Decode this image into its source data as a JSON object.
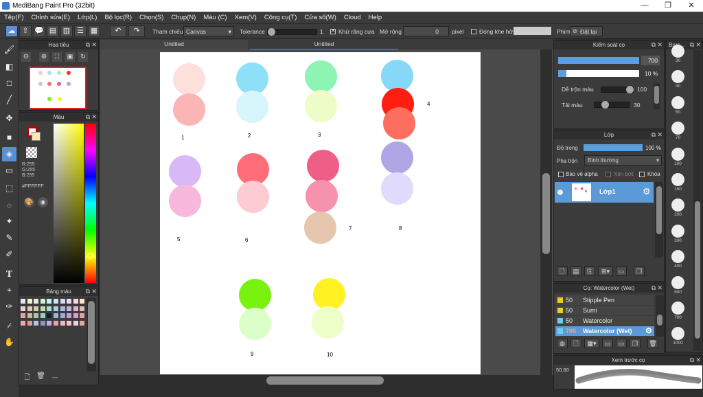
{
  "window": {
    "title": "MediBang Paint Pro (32bit)",
    "minimize": "—",
    "maximize": "❐",
    "close": "✕"
  },
  "menu": [
    "Tệp(F)",
    "Chỉnh sửa(E)",
    "Lớp(L)",
    "Bộ lọc(R)",
    "Chọn(S)",
    "Chụp(N)",
    "Màu (C)",
    "Xem(V)",
    "Công cụ(T)",
    "Cửa sổ(W)",
    "Cloud",
    "Help"
  ],
  "toolbar": {
    "reference_label": "Tham chiếu",
    "reference_value": "Canvas",
    "tolerance_label": "Tolerance",
    "tolerance_value": "1",
    "antialias_label": "Khử răng cưa",
    "expand_label": "Mở rộng",
    "expand_value": "0",
    "expand_unit": "pixel",
    "close_gap_label": "Đóng khe hở",
    "key_label": "Phím",
    "reset_label": "Đặt lại"
  },
  "navigator": {
    "title": "Hoa tiêu"
  },
  "color": {
    "title": "Màu",
    "r": "R:255",
    "g": "G:255",
    "b": "B:255",
    "hex": "#FFFFFF",
    "fg": "#c00000",
    "bg": "#f6e9b0"
  },
  "palette": {
    "title": "Bảng màu",
    "footer": "---",
    "colors": [
      "#e8e8e8",
      "#f0f0d0",
      "#e0f0d8",
      "#d0f0e0",
      "#c8f0f0",
      "#d0e0f8",
      "#d8d8f8",
      "#f0d8f0",
      "#f8d8e0",
      "#f8e8d0",
      "#f0d0d0",
      "#e8c8b0",
      "#d0d0a8",
      "#b8e0b0",
      "#a8e0d0",
      "#a8d0e8",
      "#b0b8e8",
      "#c8b0e8",
      "#e8b0d0",
      "#e8b8b8",
      "#d8a8a8",
      "#c8b8a0",
      "#a8c8a0",
      "#98d0c0",
      "#102030",
      "#98b8d8",
      "#a0a8d8",
      "#c0a0d8",
      "#d8a0c0",
      "#e0a0a0",
      "#f0a8a8",
      "#e09898",
      "#b0c8e8",
      "#8898c0",
      "#c0b0e0",
      "#e8a0b0",
      "#f0b8c0",
      "#f8c0c8",
      "#f0d0e0",
      "#e0a8a8"
    ]
  },
  "canvas": {
    "tabs": [
      "Untitled",
      "Untitled"
    ],
    "labels": [
      "1",
      "2",
      "3",
      "4",
      "5",
      "6",
      "7",
      "8",
      "9",
      "10"
    ],
    "circles": [
      "#fde0dc",
      "#fbb5b5",
      "#8ee0f8",
      "#d6f6fb",
      "#8ef4b4",
      "#eefdc8",
      "#86d8f8",
      "#ff1e10",
      "#ff6e5e",
      "#d9b8f6",
      "#f6b8dc",
      "#ff6e78",
      "#fdcbd2",
      "#ee5e86",
      "#f692ae",
      "#e6c6ae",
      "#b0a6e6",
      "#e0dafc",
      "#7af210",
      "#dcfec8",
      "#fff122",
      "#eefec8"
    ]
  },
  "brush_control": {
    "title": "Kiểm soát cọ",
    "size": "700",
    "opacity": "10 %",
    "blend_label": "Dễ trộn màu",
    "blend_value": "100",
    "reload_label": "Tải màu",
    "reload_value": "30"
  },
  "layers": {
    "title": "Lớp",
    "opacity_label": "Độ trong",
    "opacity_value": "100 %",
    "blend_label": "Pha trộn",
    "blend_value": "Bình thường",
    "protect_alpha": "Bảo vệ alpha",
    "clipping": "Xén bớt",
    "lock": "Khóa",
    "layer_name": "Lớp1"
  },
  "brushes": {
    "title": "Cọ: Watercolor (Wet)",
    "items": [
      {
        "size": "50",
        "name": "Stipple Pen",
        "color": "#e8d020"
      },
      {
        "size": "50",
        "name": "Sumi",
        "color": "#e8d020"
      },
      {
        "size": "50",
        "name": "Watercolor",
        "color": "#6ad0f0"
      },
      {
        "size": "700",
        "name": "Watercolor (Wet)",
        "color": "#6ad0f0"
      }
    ]
  },
  "brush_sizes": {
    "title": "Brus...",
    "values": [
      "30",
      "40",
      "50",
      "70",
      "100",
      "150",
      "200",
      "300",
      "400",
      "500",
      "700",
      "1000"
    ]
  },
  "preview": {
    "title": "Xem trước cọ",
    "value": "50.80"
  }
}
